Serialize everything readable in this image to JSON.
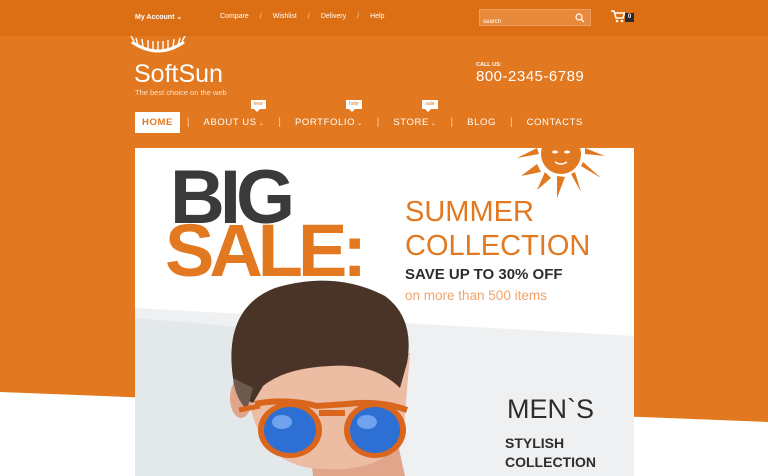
{
  "topbar": {
    "my_account": "My Account",
    "links": [
      "Compare",
      "Wishlist",
      "Delivery",
      "Help"
    ],
    "search_placeholder": "search",
    "cart_count": "0"
  },
  "header": {
    "logo": "SoftSun",
    "tagline": "The best choice on the web",
    "call_label": "CALL US:",
    "phone": "800-2345-6789"
  },
  "nav": {
    "items": [
      {
        "label": "HOME"
      },
      {
        "label": "ABOUT US",
        "tag": "new"
      },
      {
        "label": "PORTFOLIO",
        "tag": "hote"
      },
      {
        "label": "STORE",
        "tag": "sale"
      },
      {
        "label": "BLOG"
      },
      {
        "label": "CONTACTS"
      }
    ]
  },
  "banner": {
    "big": "BIG",
    "sale": "SALE:",
    "headline_1": "SUMMER",
    "headline_2": "COLLECTION",
    "offer": "SAVE UP TO 30% OFF",
    "sub": "on more than 500 items",
    "side_1": "MEN`S",
    "side_2": "STYLISH",
    "side_3": "COLLECTION"
  },
  "colors": {
    "accent": "#e2781f",
    "dark": "#2d2d2d"
  }
}
